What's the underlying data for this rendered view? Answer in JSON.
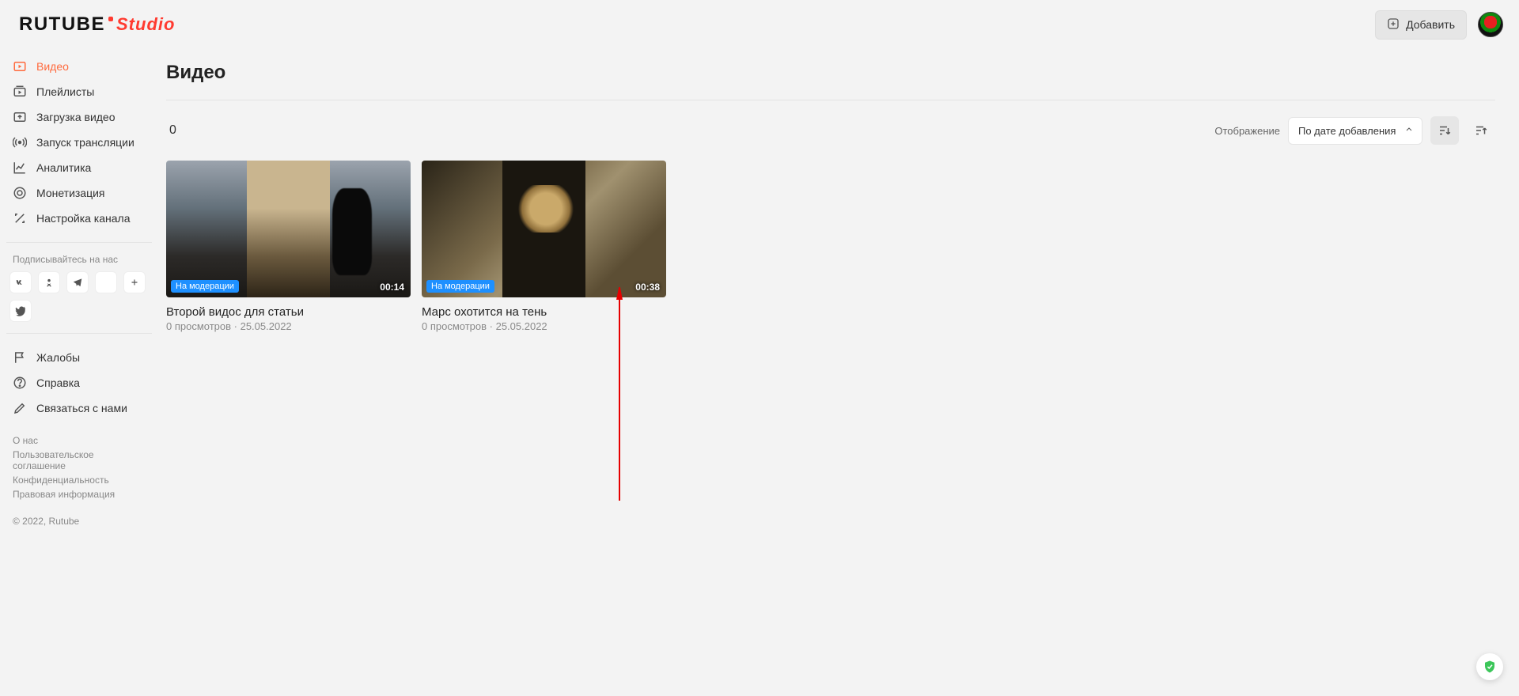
{
  "header": {
    "logo_main": "RUTUBE",
    "logo_studio": "Studio",
    "add_label": "Добавить"
  },
  "sidebar": {
    "items": [
      {
        "label": "Видео"
      },
      {
        "label": "Плейлисты"
      },
      {
        "label": "Загрузка видео"
      },
      {
        "label": "Запуск трансляции"
      },
      {
        "label": "Аналитика"
      },
      {
        "label": "Монетизация"
      },
      {
        "label": "Настройка канала"
      }
    ],
    "subscribe_label": "Подписывайтесь на нас",
    "support": [
      {
        "label": "Жалобы"
      },
      {
        "label": "Справка"
      },
      {
        "label": "Связаться с нами"
      }
    ],
    "footer": [
      "О нас",
      "Пользовательское соглашение",
      "Конфиденциальность",
      "Правовая информация"
    ],
    "copyright": "© 2022, Rutube"
  },
  "main": {
    "title": "Видео",
    "count": "0",
    "display_label": "Отображение",
    "sort_value": "По дате добавления"
  },
  "videos": [
    {
      "title": "Второй видос для статьи",
      "sub": "0 просмотров · 25.05.2022",
      "badge": "На модерации",
      "duration": "00:14"
    },
    {
      "title": "Марс охотится на тень",
      "sub": "0 просмотров · 25.05.2022",
      "badge": "На модерации",
      "duration": "00:38"
    }
  ]
}
